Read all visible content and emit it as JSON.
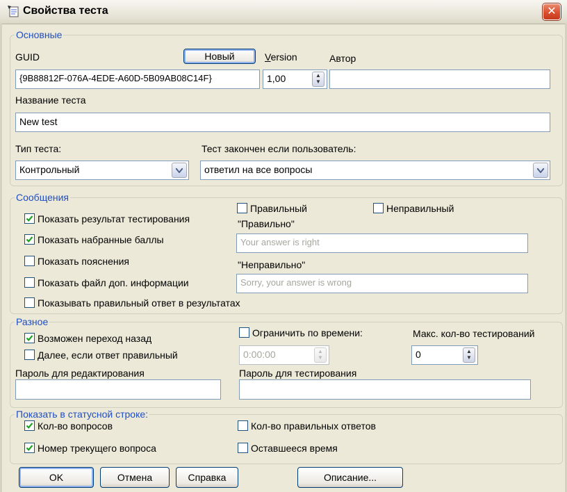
{
  "window": {
    "title": "Свойства теста",
    "close_glyph": "✕"
  },
  "basic": {
    "legend": "Основные",
    "guid_label": "GUID",
    "new_button": "Новый",
    "version_label_first": "V",
    "version_label_rest": "ersion",
    "author_label": "Автор",
    "guid_value": "{9B88812F-076A-4EDE-A60D-5B09AB08C14F}",
    "version_value": "1,00",
    "author_value": "",
    "test_name_label": "Название теста",
    "test_name_value": "New test",
    "test_type_label": "Тип теста:",
    "test_type_value": "Контрольный",
    "finish_label": "Тест закончен если пользователь:",
    "finish_value": "ответил на все вопросы"
  },
  "messages": {
    "legend": "Сообщения",
    "show_result": {
      "label": "Показать результат тестирования",
      "checked": true
    },
    "show_points": {
      "label": "Показать набранные баллы",
      "checked": true
    },
    "show_explanations": {
      "label": "Показать пояснения",
      "checked": false
    },
    "show_info_file": {
      "label": "Показать файл доп. информации",
      "checked": false
    },
    "show_correct_answer": {
      "label": "Показывать правильный ответ в результатах",
      "checked": false
    },
    "correct_check": {
      "label": "Правильный",
      "checked": false
    },
    "incorrect_check": {
      "label": "Неправильный",
      "checked": false
    },
    "correct_msg_label": "\"Правильно\"",
    "correct_msg_placeholder": "Your answer is right",
    "incorrect_msg_label": "\"Неправильно\"",
    "incorrect_msg_placeholder": "Sorry, your answer is wrong"
  },
  "misc": {
    "legend": "Разное",
    "allow_back": {
      "label": "Возможен переход назад",
      "checked": true
    },
    "next_if_correct": {
      "label": "Далее, если ответ правильный",
      "checked": false
    },
    "time_limit": {
      "label": "Ограничить по времени:",
      "checked": false
    },
    "time_value": "0:00:00",
    "max_attempts_label": "Макс. кол-во тестирований",
    "max_attempts_value": "0",
    "edit_password_label": "Пароль для редактирования",
    "edit_password_value": "",
    "test_password_label": "Пароль для тестирования",
    "test_password_value": ""
  },
  "statusbar": {
    "legend": "Показать в статусной строке:",
    "question_count": {
      "label": "Кол-во вопросов",
      "checked": true
    },
    "current_question": {
      "label": "Номер трекущего вопроса",
      "checked": true
    },
    "correct_count": {
      "label": "Кол-во правильных ответов",
      "checked": false
    },
    "remaining_time": {
      "label": "Оставшееся время",
      "checked": false
    }
  },
  "buttons": {
    "ok": "OK",
    "cancel": "Отмена",
    "help": "Справка",
    "description": "Описание..."
  },
  "icons": {
    "title": "test-properties-icon",
    "close": "close-icon",
    "dropdown": "chevron-down-icon",
    "spinner": "spin-updown-icon",
    "check": "checkmark-icon"
  },
  "colors": {
    "dialog_bg": "#ece9d8",
    "legend_blue": "#1f4ec6",
    "check_green": "#21a121",
    "close_red": "#d9502f"
  }
}
